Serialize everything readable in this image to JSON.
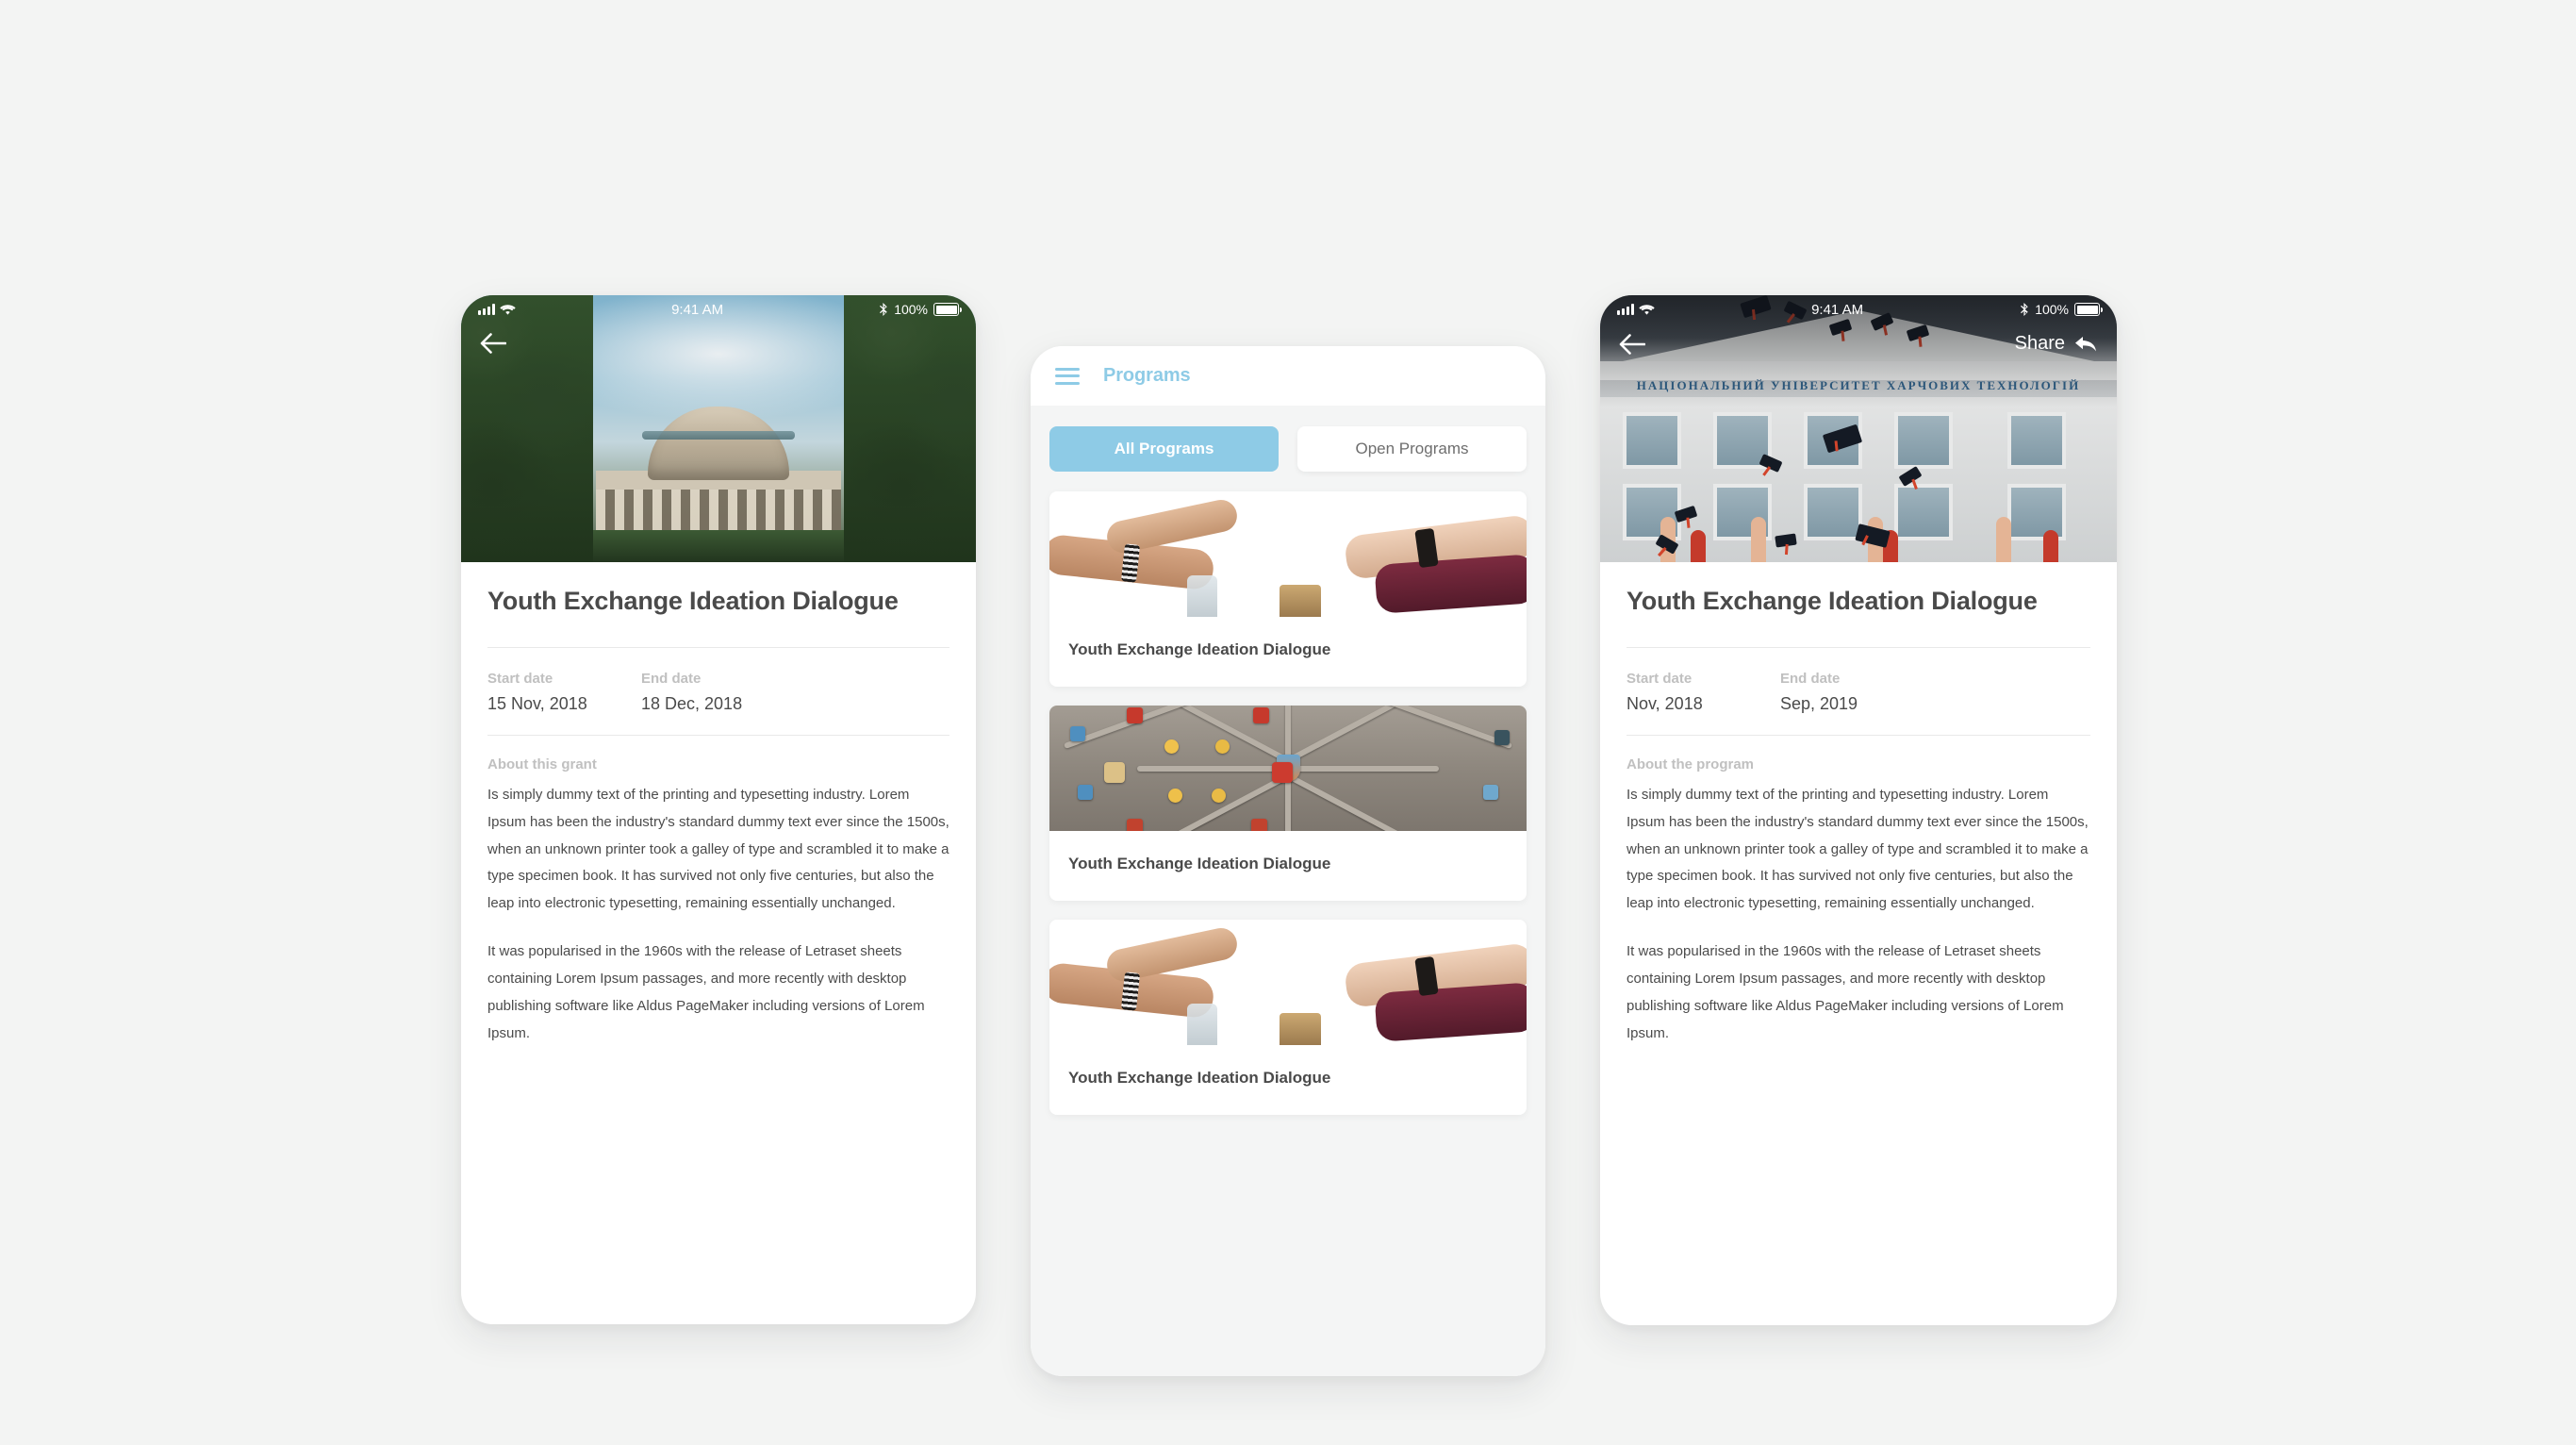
{
  "background_color": "#f3f4f3",
  "accent_color": "#8ecbe6",
  "text_color": "#4a4a4a",
  "muted_color": "#c0c0c0",
  "status_bar": {
    "time": "9:41 AM",
    "battery_percent": "100%",
    "icons": [
      "signal-bars-icon",
      "wifi-icon",
      "bluetooth-icon",
      "battery-icon"
    ]
  },
  "grant_detail_screen": {
    "name": "Grant detail screen",
    "back_icon": "back-arrow-icon",
    "hero_photo": "mit-dome-campus-photo",
    "title": "Youth Exchange Ideation Dialogue",
    "start_date_label": "Start date",
    "start_date_value": "15 Nov, 2018",
    "end_date_label": "End date",
    "end_date_value": "18 Dec, 2018",
    "about_label": "About this grant",
    "paragraphs": [
      "Is simply dummy text of the printing and typesetting industry. Lorem Ipsum has been the industry's standard dummy text ever since the 1500s, when an unknown printer took a galley of type and scrambled it to make a type specimen book. It has survived not only five centuries, but also the leap into electronic typesetting, remaining essentially unchanged.",
      "It was popularised in the 1960s with the release of Letraset sheets containing Lorem Ipsum passages, and more recently with desktop publishing software like Aldus PageMaker including versions of Lorem Ipsum."
    ]
  },
  "programs_list_screen": {
    "name": "Programs list screen",
    "menu_icon": "hamburger-menu-icon",
    "header_title": "Programs",
    "tabs": [
      {
        "label": "All Programs",
        "active": true
      },
      {
        "label": "Open Programs",
        "active": false
      }
    ],
    "cards": [
      {
        "title": "Youth Exchange Ideation Dialogue",
        "photo": "fist-bump-teamwork-photo"
      },
      {
        "title": "Youth Exchange Ideation Dialogue",
        "photo": "gothic-vaulted-ceiling-photo"
      },
      {
        "title": "Youth Exchange Ideation Dialogue",
        "photo": "fist-bump-teamwork-photo"
      }
    ]
  },
  "program_detail_screen": {
    "name": "Program detail screen",
    "back_icon": "back-arrow-icon",
    "share_label": "Share",
    "share_icon": "share-reply-arrow-icon",
    "hero_photo": "graduation-caps-thrown-photo",
    "hero_building_text": "НАЦІОНАЛЬНИЙ УНІВЕРСИТЕТ ХАРЧОВИХ ТЕХНОЛОГІЙ",
    "title": "Youth Exchange Ideation Dialogue",
    "start_date_label": "Start date",
    "start_date_value": "Nov, 2018",
    "end_date_label": "End date",
    "end_date_value": "Sep, 2019",
    "about_label": "About the program",
    "paragraphs": [
      "Is simply dummy text of the printing and typesetting industry. Lorem Ipsum has been the industry's standard dummy text ever since the 1500s, when an unknown printer took a galley of type and scrambled it to make a type specimen book. It has survived not only five centuries, but also the leap into electronic typesetting, remaining essentially unchanged.",
      "It was popularised in the 1960s with the release of Letraset sheets containing Lorem Ipsum passages, and more recently with desktop publishing software like Aldus PageMaker including versions of Lorem Ipsum."
    ]
  }
}
